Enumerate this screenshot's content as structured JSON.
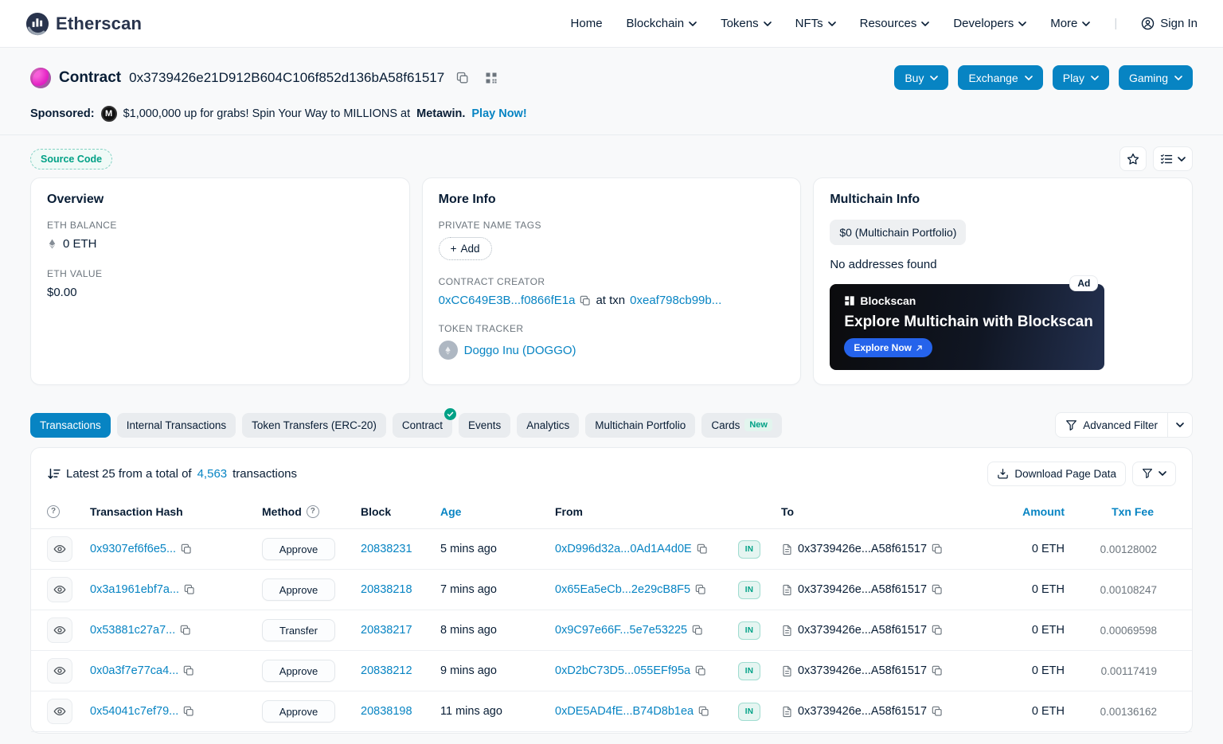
{
  "colors": {
    "accent": "#0784c3",
    "brand_navy": "#21325b",
    "success": "#00a186",
    "text_muted": "#6c757d"
  },
  "brand": {
    "name": "Etherscan"
  },
  "nav": {
    "items": [
      "Home",
      "Blockchain",
      "Tokens",
      "NFTs",
      "Resources",
      "Developers",
      "More"
    ],
    "sign_in": "Sign In"
  },
  "contract_header": {
    "label": "Contract",
    "address": "0x3739426e21D912B604C106f852d136bA58f61517",
    "buttons": [
      "Buy",
      "Exchange",
      "Play",
      "Gaming"
    ]
  },
  "sponsored": {
    "label": "Sponsored:",
    "text": "$1,000,000 up for grabs! Spin Your Way to MILLIONS at",
    "advertiser": "Metawin.",
    "cta": "Play Now!"
  },
  "source_code_badge": "Source Code",
  "overview": {
    "title": "Overview",
    "eth_balance_label": "ETH BALANCE",
    "eth_balance": "0 ETH",
    "eth_value_label": "ETH VALUE",
    "eth_value": "$0.00"
  },
  "more_info": {
    "title": "More Info",
    "private_name_tags_label": "PRIVATE NAME TAGS",
    "add_button": "Add",
    "contract_creator_label": "CONTRACT CREATOR",
    "creator_address": "0xCC649E3B...f0866fE1a",
    "at_txn_label": "at txn",
    "creation_txn": "0xeaf798cb99b...",
    "token_tracker_label": "TOKEN TRACKER",
    "token_name": "Doggo Inu (DOGGO)"
  },
  "multichain": {
    "title": "Multichain Info",
    "portfolio_button": "$0 (Multichain Portfolio)",
    "no_addresses": "No addresses found",
    "ad": {
      "badge": "Ad",
      "brand": "Blockscan",
      "headline": "Explore Multichain with Blockscan",
      "cta": "Explore Now"
    }
  },
  "tabs": {
    "items": [
      "Transactions",
      "Internal Transactions",
      "Token Transfers (ERC-20)",
      "Contract",
      "Events",
      "Analytics",
      "Multichain Portfolio",
      "Cards"
    ],
    "active": "Transactions",
    "new_badge": "New"
  },
  "advanced_filter": "Advanced Filter",
  "tx_panel": {
    "summary_prefix": "Latest 25 from a total of",
    "summary_count": "4,563",
    "summary_suffix": "transactions",
    "download_button": "Download Page Data",
    "columns": {
      "hash": "Transaction Hash",
      "method": "Method",
      "block": "Block",
      "age": "Age",
      "from": "From",
      "to": "To",
      "amount": "Amount",
      "fee": "Txn Fee"
    },
    "rows": [
      {
        "hash": "0x9307ef6f6e5...",
        "method": "Approve",
        "block": "20838231",
        "age": "5 mins ago",
        "from": "0xD996d32a...0Ad1A4d0E",
        "direction": "IN",
        "to": "0x3739426e...A58f61517",
        "amount": "0 ETH",
        "fee": "0.00128002"
      },
      {
        "hash": "0x3a1961ebf7a...",
        "method": "Approve",
        "block": "20838218",
        "age": "7 mins ago",
        "from": "0x65Ea5eCb...2e29cB8F5",
        "direction": "IN",
        "to": "0x3739426e...A58f61517",
        "amount": "0 ETH",
        "fee": "0.00108247"
      },
      {
        "hash": "0x53881c27a7...",
        "method": "Transfer",
        "block": "20838217",
        "age": "8 mins ago",
        "from": "0x9C97e66F...5e7e53225",
        "direction": "IN",
        "to": "0x3739426e...A58f61517",
        "amount": "0 ETH",
        "fee": "0.00069598"
      },
      {
        "hash": "0x0a3f7e77ca4...",
        "method": "Approve",
        "block": "20838212",
        "age": "9 mins ago",
        "from": "0xD2bC73D5...055EFf95a",
        "direction": "IN",
        "to": "0x3739426e...A58f61517",
        "amount": "0 ETH",
        "fee": "0.00117419"
      },
      {
        "hash": "0x54041c7ef79...",
        "method": "Approve",
        "block": "20838198",
        "age": "11 mins ago",
        "from": "0xDE5AD4fE...B74D8b1ea",
        "direction": "IN",
        "to": "0x3739426e...A58f61517",
        "amount": "0 ETH",
        "fee": "0.00136162"
      }
    ]
  }
}
